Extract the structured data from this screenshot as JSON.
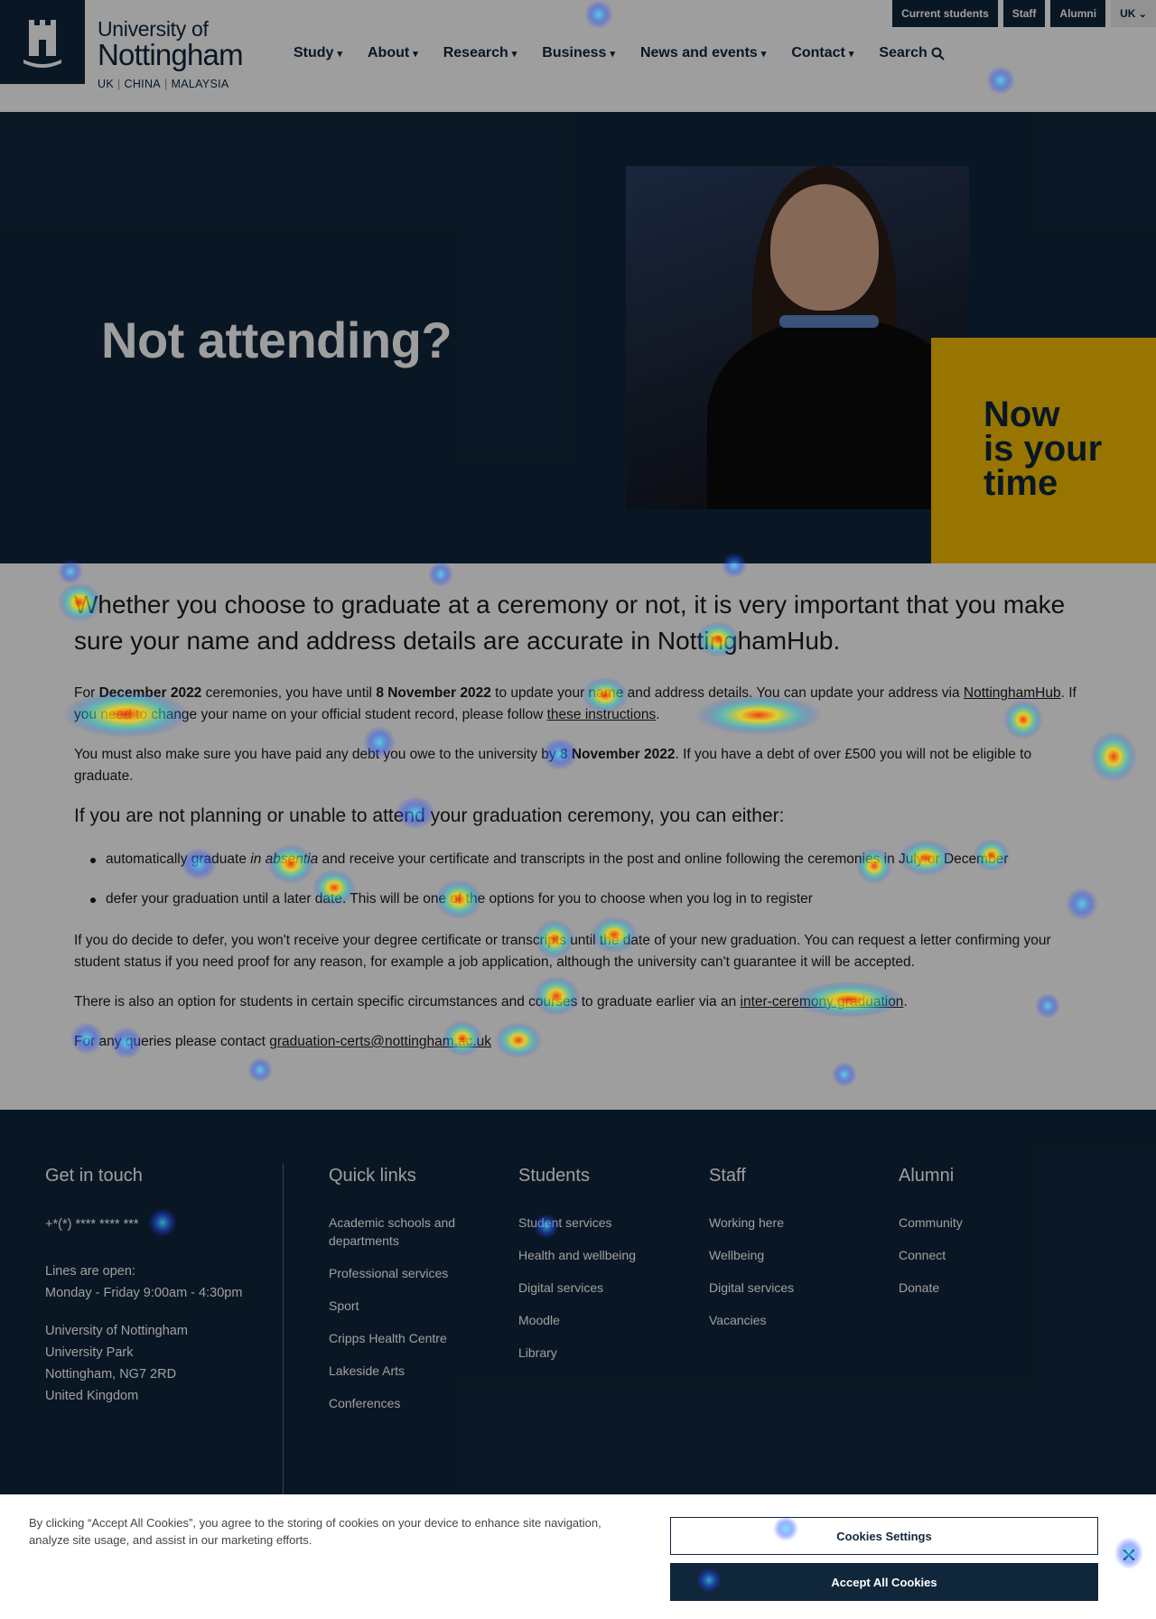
{
  "header": {
    "logo_line1": "University of",
    "logo_line2": "Nottingham",
    "logo_sub": [
      "UK",
      "CHINA",
      "MALAYSIA"
    ],
    "topbar": {
      "current_students": "Current students",
      "staff": "Staff",
      "alumni": "Alumni",
      "region": "UK"
    },
    "nav": [
      {
        "label": "Study",
        "icon": "chevron-down-icon"
      },
      {
        "label": "About",
        "icon": "chevron-down-icon"
      },
      {
        "label": "Research",
        "icon": "chevron-down-icon"
      },
      {
        "label": "Business",
        "icon": "chevron-down-icon"
      },
      {
        "label": "News and events",
        "icon": "chevron-down-icon"
      },
      {
        "label": "Contact",
        "icon": "chevron-down-icon"
      },
      {
        "label": "Search",
        "icon": "search-icon"
      }
    ]
  },
  "hero": {
    "title": "Not attending?",
    "yellow_line1": "Now",
    "yellow_line2": "is your",
    "yellow_line3": "time"
  },
  "content": {
    "lead": "Whether you choose to graduate at a ceremony or not, it is very important that you make sure your name and address details are accurate in NottinghamHub.",
    "p1_a": "For ",
    "p1_b": "December 2022",
    "p1_c": " ceremonies, you have until ",
    "p1_d": "8 November 2022",
    "p1_e": " to update your name and address details. You can update your address via ",
    "p1_link1": "NottinghamHub",
    "p1_f": ". If you need to change your name on your official student record, please follow ",
    "p1_link2": "these instructions",
    "p1_g": ".",
    "p2_a": "You must also make sure you have paid any debt you owe to the university by ",
    "p2_b": "8 November 2022",
    "p2_c": ". If you have a debt of over £500 you will not be eligible to graduate.",
    "h3": "If you are not planning or unable to attend your graduation ceremony, you can either:",
    "li1_a": "automatically graduate ",
    "li1_b": "in absentia",
    "li1_c": " and receive your certificate and transcripts in the post and online following the ceremonies in July or December",
    "li2": "defer your graduation until a later date. This will be one of the options for you to choose when you log in to register",
    "p3": "If you do decide to defer, you won't receive your degree certificate or transcripts until the date of your new graduation. You can request a letter confirming your student status if you need proof for any reason, for example a job application, although the university can't guarantee it will be accepted.",
    "p4_a": "There is also an option for students in certain specific circumstances and courses to graduate earlier via an ",
    "p4_link": "inter-ceremony graduation",
    "p4_b": ".",
    "p5_a": "For any queries please contact ",
    "p5_link": "graduation-certs@nottingham.ac.uk"
  },
  "footer": {
    "get_in_touch": {
      "heading": "Get in touch",
      "phone": "+*(*) **** **** ***",
      "lines_label": "Lines are open:",
      "hours": "Monday - Friday 9:00am - 4:30pm",
      "address": [
        "University of Nottingham",
        "University Park",
        "Nottingham, NG7 2RD",
        "United Kingdom"
      ]
    },
    "quick_links": {
      "heading": "Quick links",
      "items": [
        "Academic schools and departments",
        "Professional services",
        "Sport",
        "Cripps Health Centre",
        "Lakeside Arts",
        "Conferences"
      ]
    },
    "students": {
      "heading": "Students",
      "items": [
        "Student services",
        "Health and wellbeing",
        "Digital services",
        "Moodle",
        "Library"
      ]
    },
    "staff": {
      "heading": "Staff",
      "items": [
        "Working here",
        "Wellbeing",
        "Digital services",
        "Vacancies"
      ]
    },
    "alumni": {
      "heading": "Alumni",
      "items": [
        "Community",
        "Connect",
        "Donate"
      ]
    }
  },
  "cookie": {
    "text": "By clicking “Accept All Cookies”, you agree to the storing of cookies on your device to enhance site navigation, analyze site usage, and assist in our marketing efforts.",
    "settings_label": "Cookies Settings",
    "accept_label": "Accept All Cookies",
    "close_icon": "close-icon"
  },
  "colors": {
    "brand_navy": "#10263b",
    "accent_yellow": "#f5bd00",
    "overlay": "#000000"
  }
}
